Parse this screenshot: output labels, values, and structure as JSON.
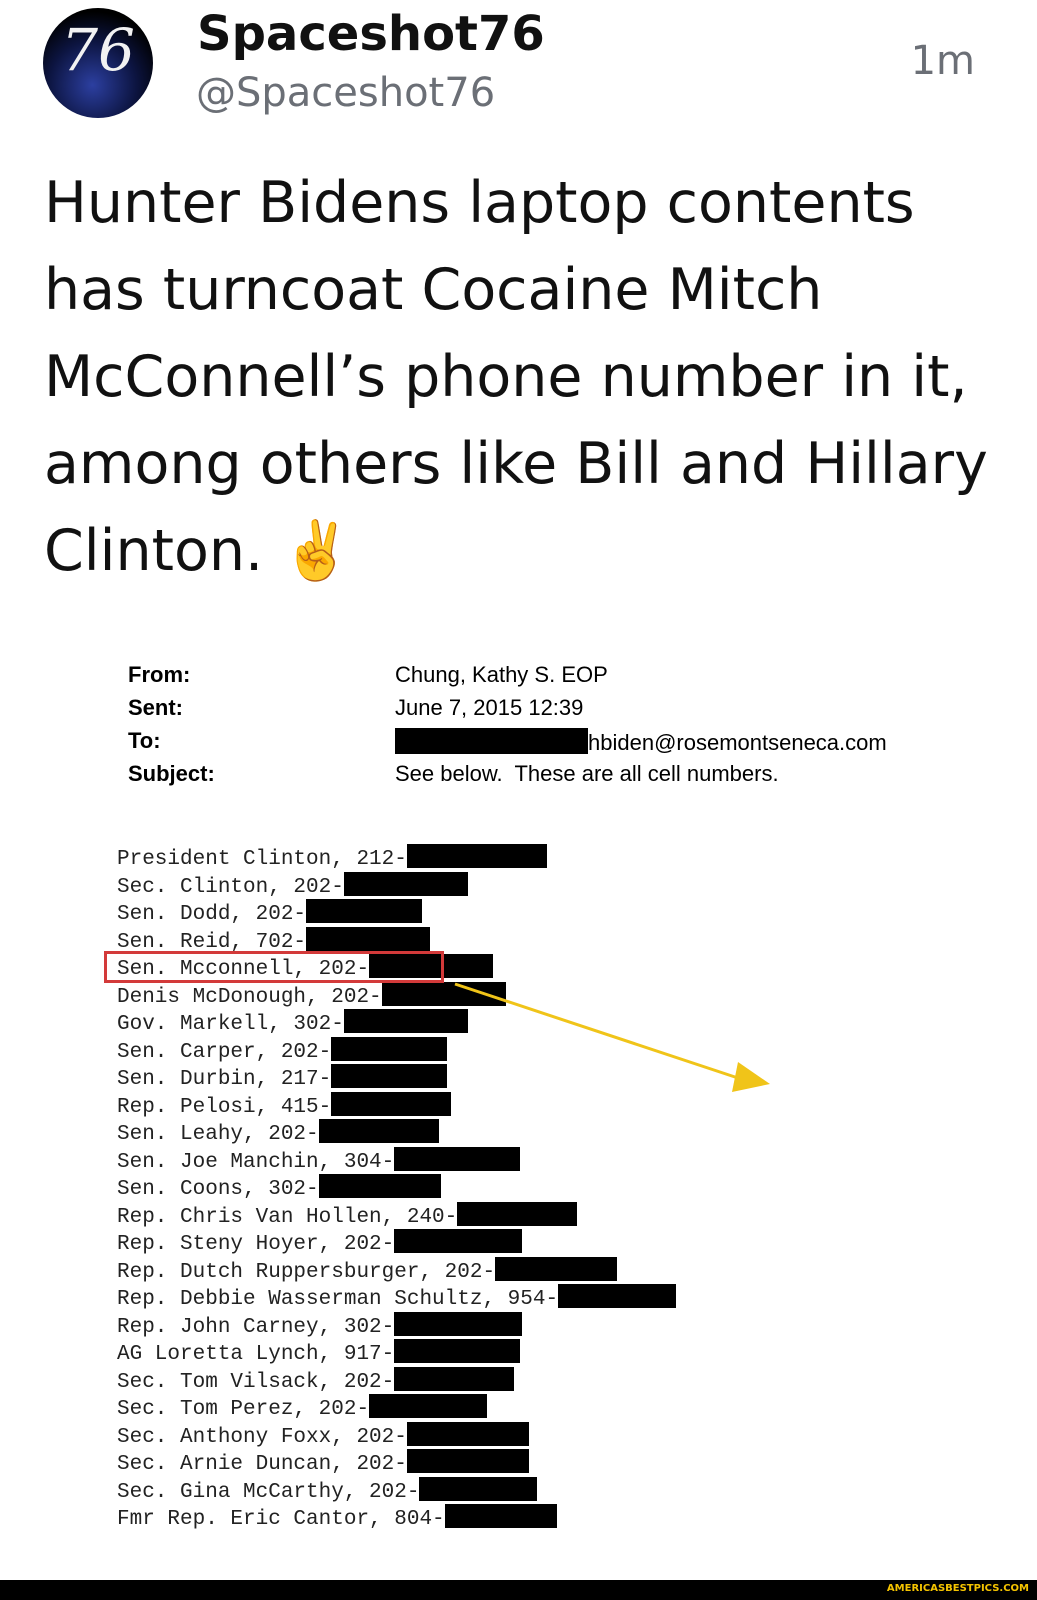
{
  "post": {
    "avatar_icon": "spaceshot-76-logo-icon",
    "display_name": "Spaceshot76",
    "handle": "@Spaceshot76",
    "time": "1m",
    "text": "Hunter Bidens laptop contents has turncoat Cocaine Mitch McConnell’s phone number in it, among others like Bill and Hillary Clinton. ✌️"
  },
  "email": {
    "headers": [
      {
        "label": "From:",
        "value": "Chung, Kathy S. EOP"
      },
      {
        "label": "Sent:",
        "value": "June 7, 2015 12:39"
      },
      {
        "label": "To:",
        "value": "hbiden@rosemontseneca.com"
      },
      {
        "label": "Subject:",
        "value": "See below.  These are all cell numbers."
      }
    ],
    "contacts": [
      "President Clinton, 212-",
      "Sec. Clinton, 202-",
      "Sen. Dodd, 202-",
      "Sen. Reid, 702-",
      "Sen. Mcconnell, 202-",
      "Denis McDonough, 202-",
      "Gov. Markell, 302-",
      "Sen. Carper, 202-",
      "Sen. Durbin, 217-",
      "Rep. Pelosi, 415-",
      "Sen. Leahy, 202-",
      "Sen. Joe Manchin, 304-",
      "Sen. Coons, 302-",
      "Rep. Chris Van Hollen, 240-",
      "Rep. Steny Hoyer, 202-",
      "Rep. Dutch Ruppersburger, 202-",
      "Rep. Debbie Wasserman Schultz, 954-",
      "Rep. John Carney, 302-",
      "AG Loretta Lynch, 917-",
      "Sec. Tom Vilsack, 202-",
      "Sec. Tom Perez, 202-",
      "Sec. Anthony Foxx, 202-",
      "Sec. Arnie Duncan, 202-",
      "Sec. Gina McCarthy, 202-",
      "Fmr Rep. Eric Cantor, 804-"
    ],
    "highlight_color": "#d33a3a",
    "arrow_color": "#f0c419"
  },
  "footer": {
    "watermark": "AMERICASBESTPICS.COM"
  }
}
